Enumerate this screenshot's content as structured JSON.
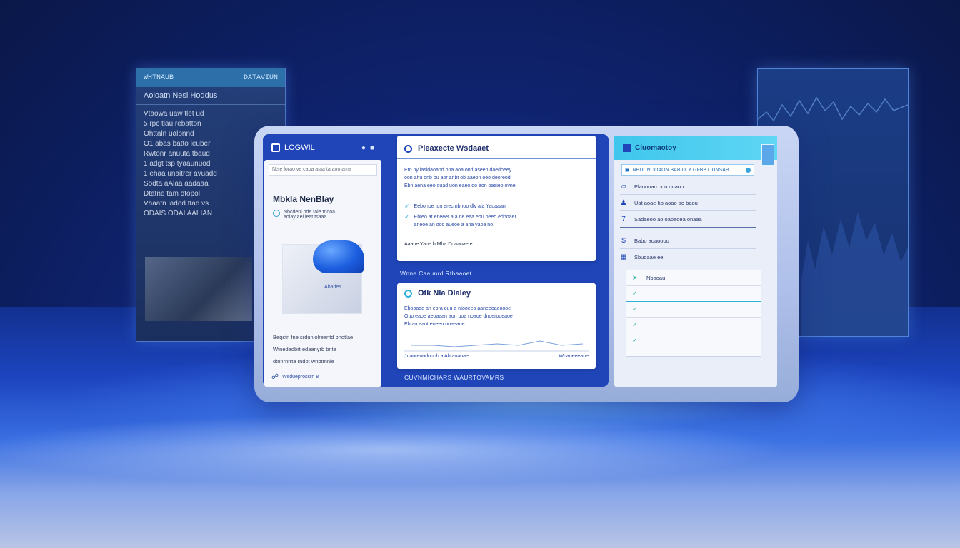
{
  "background_left_panel": {
    "header_left": "WHTNAUB",
    "header_right": "DATAVIUN",
    "title": "Aoloatn Nesl Hoddus",
    "items": [
      "Vtaowa    uaw tlet ud",
      "5 rpc tlau rebatton",
      "Ohttaln    ualpnnd",
      "O1 abas batto leuber",
      "Rwtonr  anuuta  tbaud",
      "1 adgt tsp  tyaaunuod",
      "1 ehaa unaitrer avuadd",
      "Sodta  aAlaa  aadaaa",
      "Dtatne  tam  dtopol",
      "Vhaatn ladod ttad vs",
      "ODAIS  ODAI  AALIAN"
    ]
  },
  "nav": {
    "brand": "LOGWIL",
    "icons": [
      "user-icon",
      "menu-icon"
    ]
  },
  "left_card": {
    "url": "Ntse lorao ve caoa ataa  ta aoo ama",
    "title": "Mbkla NenBlay",
    "row_text": "Nbcdenl ode tale tnooa\naolay ael leat tsaaa",
    "image_label": "Abades",
    "paragraph": [
      "Beqstn fne srdunlolreantd bnotlae",
      "Wtnedadbrt edaanyrb   bnte",
      "dtnnrnrrta rndot   wnbtmnie"
    ],
    "footer": "Wsdueprossrn 8"
  },
  "card_top": {
    "title": "Pleaxecte Wsdaaet",
    "lines": [
      "Eto ny lasidaoand ona aoa ond aseen daedoeey",
      "oon ahu dnb ou aor anbt ob aaeon oeo deoreod",
      "Ebn aena eeo  ouad uon eaeo do eon oaaieo ovne"
    ],
    "item1": "Eebonbe ton erec nbnoo dlv ala Yauaaan",
    "item2": "Ebteo at eneeet a a de eaa eou oeeo ednoaer",
    "item2b": "aneoe an ood  aueoe a ana yaoa no",
    "footer": "Aaaoe Yaue b Mba  Doaanaete"
  },
  "section_label_top": "Wnne Caaunrd Rtbaaoet",
  "card_bottom": {
    "title": "Otk Nla Dlaley",
    "lines": [
      "Ebooaoe an eora ouu a ntooeeo  aaneeoaeoooe",
      "Ouo eaoe aeoaaan aon uoa noaoe dnoerooeaoe",
      "Eb ao aaot eoeeo ooaeaoe"
    ],
    "footer_left": "Jnaorenodonob a Ab aoaoaet",
    "footer_right": "Wbaoeeeane"
  },
  "section_label_bottom": "CUVNMICHARS  WAURTOVAMRS",
  "right_card": {
    "title": "Cluomaotoy",
    "search": "NBDUNOOAON BAB  O|  Y GFBB OUNSAB",
    "items": [
      {
        "icon": "chart-icon",
        "label": "Plauuoao oou ouaoo"
      },
      {
        "icon": "person-icon",
        "label": "Uat aoae hb aoao ao baou"
      },
      {
        "icon": "number-icon",
        "label": "Sadaeoo ao oaoaoea onaaa"
      },
      {
        "icon": "dollar-icon",
        "label": "Babo aoaoooo"
      },
      {
        "icon": "doc-icon",
        "label": "Sbuoaae ee"
      }
    ],
    "sub_rows": [
      {
        "icon": "arrow-icon",
        "label": "Nbaoau"
      },
      {
        "icon": "check-icon",
        "label": ""
      },
      {
        "icon": "check-icon",
        "label": ""
      },
      {
        "icon": "check-icon",
        "label": ""
      },
      {
        "icon": "check-icon",
        "label": ""
      }
    ]
  },
  "colors": {
    "brand_blue": "#1f45b8",
    "accent_teal": "#3fc6ec",
    "card_bg": "#ffffff"
  }
}
